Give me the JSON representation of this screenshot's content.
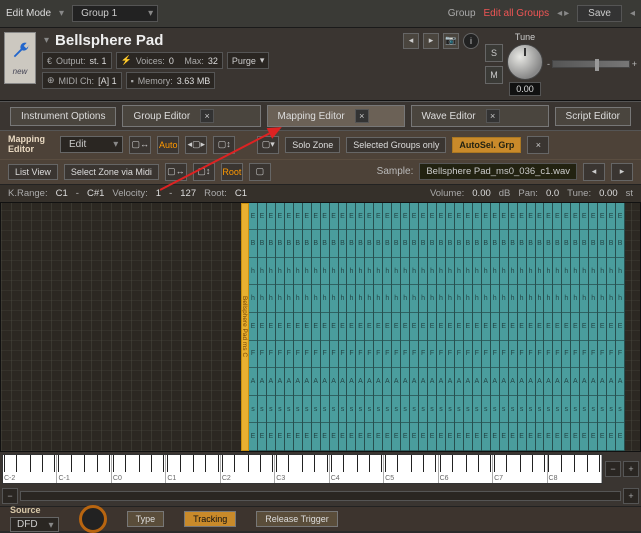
{
  "topbar": {
    "edit_mode": "Edit\nMode",
    "group_name": "Group 1",
    "group_label": "Group",
    "edit_all": "Edit all Groups",
    "save": "Save"
  },
  "instrument": {
    "title": "Bellsphere Pad",
    "new_label": "new",
    "output_label": "Output:",
    "output_value": "st. 1",
    "midi_label": "MIDI Ch:",
    "midi_value": "[A] 1",
    "voices_label": "Voices:",
    "voices_value": "0",
    "max_label": "Max:",
    "max_value": "32",
    "memory_label": "Memory:",
    "memory_value": "3.63 MB",
    "purge": "Purge",
    "solo": "S",
    "mute": "M",
    "tune_label": "Tune",
    "tune_value": "0.00"
  },
  "tabs": {
    "instrument_options": "Instrument Options",
    "group_editor": "Group Editor",
    "mapping_editor": "Mapping Editor",
    "wave_editor": "Wave Editor",
    "script_editor": "Script Editor"
  },
  "mapping": {
    "panel_title": "Mapping Editor",
    "edit": "Edit",
    "auto": "Auto",
    "solo_zone": "Solo Zone",
    "selected_groups": "Selected Groups only",
    "autosel": "AutoSel. Grp",
    "list_view": "List View",
    "select_zone_midi": "Select Zone via Midi",
    "root": "Root",
    "sample_label": "Sample:",
    "sample_value": "Bellsphere Pad_ms0_036_c1.wav",
    "krange_label": "K.Range:",
    "krange_lo": "C1",
    "krange_hi": "C#1",
    "velocity_label": "Velocity:",
    "vel_lo": "1",
    "vel_hi": "127",
    "root_label": "Root:",
    "root_val": "C1",
    "volume_label": "Volume:",
    "volume_val": "0.00",
    "volume_unit": "dB",
    "pan_label": "Pan:",
    "pan_val": "0.0",
    "tune_label": "Tune:",
    "tune_val": "0.00",
    "tune_unit": "st"
  },
  "keyboard": {
    "octaves": [
      "C-2",
      "C-1",
      "C0",
      "C1",
      "C2",
      "C3",
      "C4",
      "C5",
      "C6",
      "C7",
      "C8"
    ]
  },
  "source": {
    "title": "Source",
    "dfd": "DFD",
    "type": "Type",
    "tracking": "Tracking",
    "release": "Release Trigger"
  },
  "selected_zone_label": "Bellsphere Pad ms C"
}
